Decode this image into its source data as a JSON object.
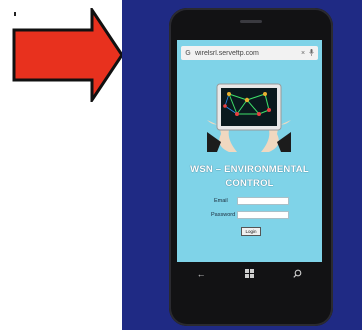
{
  "browser": {
    "url": "wirelsrl.serveftp.com",
    "google_glyph": "G",
    "close_glyph": "×",
    "mic_glyph": "🎙"
  },
  "app": {
    "title_line1": "WSN – ENVIRONMENTAL",
    "title_line2": "CONTROL",
    "email_label": "Email",
    "password_label": "Password",
    "login_label": "Login"
  },
  "nav": {
    "back_glyph": "←",
    "home_glyph": "⊞",
    "search_glyph": "⌕"
  },
  "colors": {
    "arrow": "#e8311e",
    "background_blue": "#1f2a84",
    "screen": "#7fd3e8"
  },
  "icons": [
    "arrow-icon",
    "google-icon",
    "close-icon",
    "mic-icon",
    "back-icon",
    "windows-home-icon",
    "search-icon"
  ]
}
